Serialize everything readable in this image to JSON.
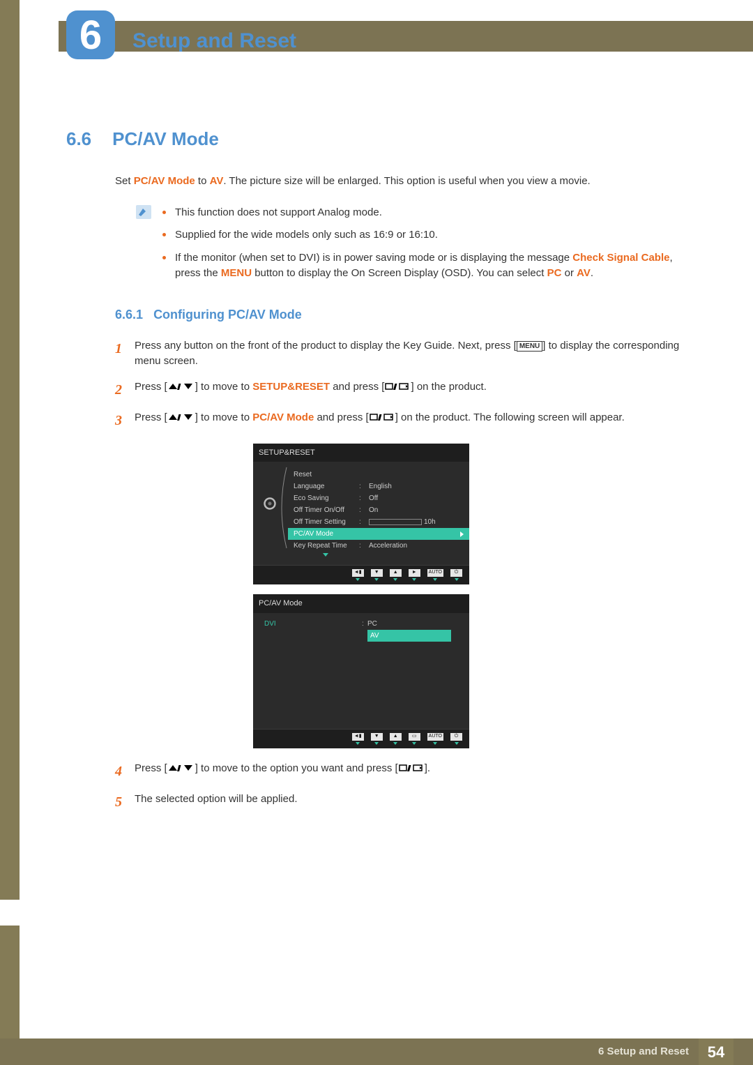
{
  "chapter": {
    "number": "6",
    "title": "Setup and Reset"
  },
  "section": {
    "number": "6.6",
    "title": "PC/AV Mode"
  },
  "intro": {
    "prefix": "Set ",
    "kw1": "PC/AV Mode",
    "mid": " to ",
    "kw2": "AV",
    "suffix": ". The picture size will be enlarged. This option is useful when you view a movie."
  },
  "notes": {
    "n1": "This function does not support Analog mode.",
    "n2": "Supplied for the wide models only such as 16:9 or 16:10.",
    "n3a": "If the monitor (when set to DVI) is in power saving mode or is displaying the message ",
    "n3_kw1": "Check Signal Cable",
    "n3b": ", press the ",
    "n3_kw2": "MENU",
    "n3c": " button to display the On Screen Display (OSD). You can select ",
    "n3_kw3": "PC",
    "n3d": " or ",
    "n3_kw4": "AV",
    "n3e": "."
  },
  "subsection": {
    "number": "6.6.1",
    "title": "Configuring PC/AV Mode"
  },
  "steps": {
    "s1": {
      "a": "Press any button on the front of the product to display the Key Guide. Next, press [",
      "menu": "MENU",
      "b": "] to display the corresponding menu screen."
    },
    "s2": {
      "a": "Press [",
      "b": "] to move to ",
      "kw": "SETUP&RESET",
      "c": " and press [",
      "d": "] on the product."
    },
    "s3": {
      "a": "Press [",
      "b": "] to move to ",
      "kw": "PC/AV Mode",
      "c": " and press [",
      "d": "] on the product. The following screen will appear."
    },
    "s4": {
      "a": "Press [",
      "b": "] to move to the option you want and press [",
      "c": "]."
    },
    "s5": "The selected option will be applied."
  },
  "osd1": {
    "title": "SETUP&RESET",
    "rows": {
      "reset": "Reset",
      "language": {
        "lbl": "Language",
        "val": "English"
      },
      "eco": {
        "lbl": "Eco Saving",
        "val": "Off"
      },
      "offtimer": {
        "lbl": "Off Timer On/Off",
        "val": "On"
      },
      "offtimerset": {
        "lbl": "Off Timer Setting",
        "val": "10h"
      },
      "pcav": {
        "lbl": "PC/AV Mode"
      },
      "keyrepeat": {
        "lbl": "Key Repeat Time",
        "val": "Acceleration"
      }
    },
    "nav": {
      "auto": "AUTO"
    }
  },
  "osd2": {
    "title": "PC/AV Mode",
    "dvi": "DVI",
    "pc": "PC",
    "av": "AV",
    "nav": {
      "auto": "AUTO"
    }
  },
  "footer": {
    "crumb": "6 Setup and Reset",
    "page": "54"
  }
}
